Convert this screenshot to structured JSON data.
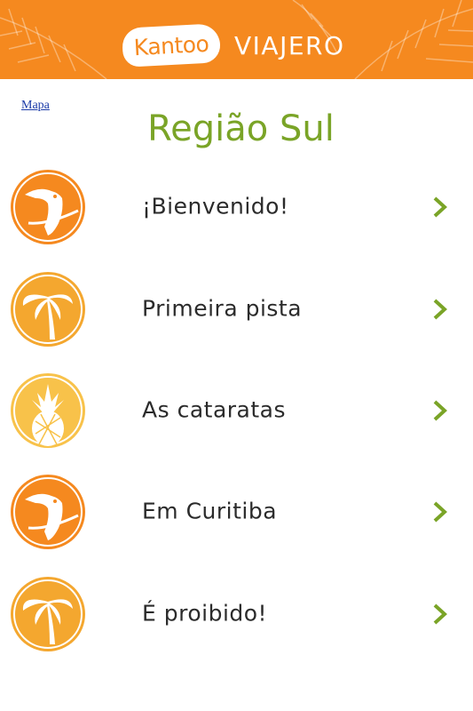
{
  "header": {
    "logo_text": "Kantoo",
    "logo_suffix": "VIAJERO",
    "bg_color": "#f5891f"
  },
  "map_link": "Mapa",
  "page_title": "Região Sul",
  "colors": {
    "title_green": "#7aa427",
    "chevron_green": "#7aa427",
    "orange": "#f5891f",
    "light_orange": "#f4a72f",
    "yellow": "#f8c24a"
  },
  "lessons": [
    {
      "label": "¡Bienvenido!",
      "icon": "toucan-icon"
    },
    {
      "label": "Primeira pista",
      "icon": "palm-tree-icon"
    },
    {
      "label": "As cataratas",
      "icon": "pineapple-icon"
    },
    {
      "label": "Em Curitiba",
      "icon": "toucan-icon"
    },
    {
      "label": "É proibido!",
      "icon": "palm-tree-icon"
    }
  ]
}
